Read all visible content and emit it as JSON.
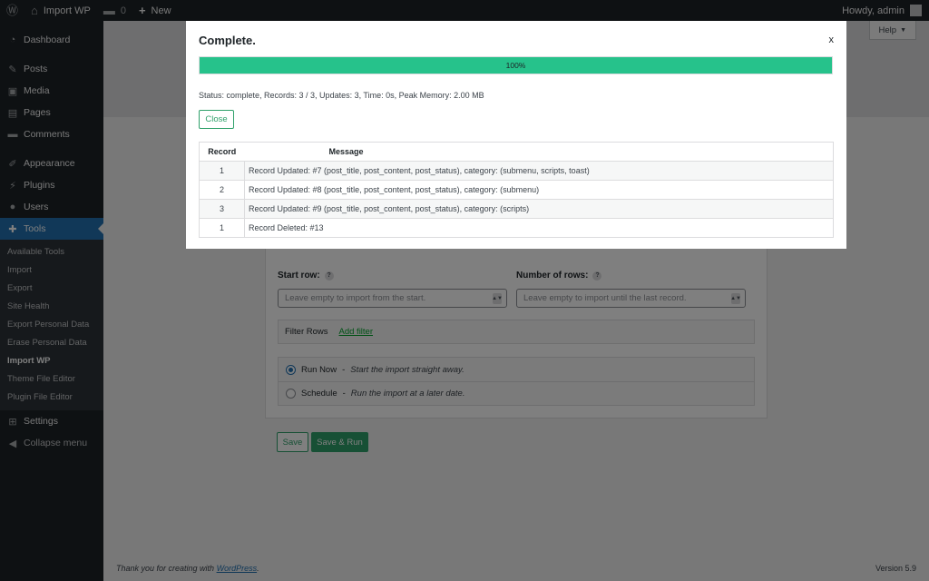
{
  "admin_bar": {
    "site_name": "Import WP",
    "comments_count": "0",
    "new_label": "New",
    "greeting": "Howdy, admin"
  },
  "sidebar": {
    "items_top": [
      {
        "label": "Dashboard",
        "icon": "dashboard-icon"
      },
      {
        "label": "Posts",
        "icon": "pin-icon"
      },
      {
        "label": "Media",
        "icon": "media-icon"
      },
      {
        "label": "Pages",
        "icon": "pages-icon"
      },
      {
        "label": "Comments",
        "icon": "comments-icon"
      },
      {
        "label": "Appearance",
        "icon": "brush-icon"
      },
      {
        "label": "Plugins",
        "icon": "plug-icon"
      },
      {
        "label": "Users",
        "icon": "users-icon"
      },
      {
        "label": "Tools",
        "icon": "wrench-icon"
      }
    ],
    "submenu": [
      "Available Tools",
      "Import",
      "Export",
      "Site Health",
      "Export Personal Data",
      "Erase Personal Data",
      "Import WP",
      "Theme File Editor",
      "Plugin File Editor"
    ],
    "items_bottom": [
      {
        "label": "Settings",
        "icon": "settings-icon"
      },
      {
        "label": "Collapse menu",
        "icon": "collapse-icon"
      }
    ]
  },
  "help_tab": {
    "label": "Help",
    "arrow": "▼"
  },
  "form": {
    "start_row_label": "Start row:",
    "start_row_placeholder": "Leave empty to import from the start.",
    "num_rows_label": "Number of rows:",
    "num_rows_placeholder": "Leave empty to import until the last record.",
    "filter_label": "Filter Rows",
    "add_filter_label": "Add filter",
    "run_now_label": "Run Now",
    "run_now_desc": "Start the import straight away.",
    "schedule_label": "Schedule",
    "schedule_desc": "Run the import at a later date.",
    "save_label": "Save",
    "save_run_label": "Save & Run",
    "run_now_selected": true
  },
  "footer": {
    "thanks_prefix": "Thank you for creating with",
    "wordpress_link": "WordPress",
    "thanks_suffix": ".",
    "version": "Version 5.9"
  },
  "modal": {
    "title": "Complete.",
    "close_x": "x",
    "progress_percent": 100,
    "progress_label": "100%",
    "status_line": "Status: complete, Records: 3 / 3, Updates: 3, Time: 0s, Peak Memory: 2.00 MB",
    "close_button": "Close",
    "table_headers": {
      "record": "Record",
      "message": "Message"
    },
    "rows": [
      {
        "record": "1",
        "message": "Record Updated: #7 (post_title, post_content, post_status), category: (submenu, scripts, toast)"
      },
      {
        "record": "2",
        "message": "Record Updated: #8 (post_title, post_content, post_status), category: (submenu)"
      },
      {
        "record": "3",
        "message": "Record Updated: #9 (post_title, post_content, post_status), category: (scripts)"
      },
      {
        "record": "1",
        "message": "Record Deleted: #13"
      }
    ]
  },
  "colors": {
    "admin_dark": "#1d2327",
    "accent_blue": "#2271b1",
    "accent_green": "#2fa06a",
    "progress_green": "#26c28b"
  }
}
